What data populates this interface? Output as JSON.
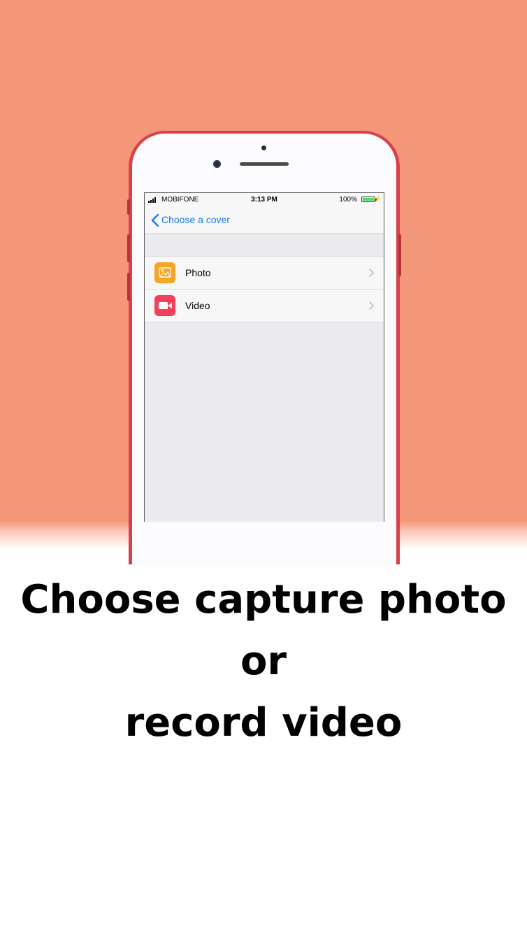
{
  "status_bar": {
    "carrier": "MOBIFONE",
    "time": "3:13 PM",
    "battery": "100%"
  },
  "nav": {
    "back_label": "Choose a cover"
  },
  "options": [
    {
      "label": "Photo",
      "icon": "photo-icon",
      "color": "#f5a623"
    },
    {
      "label": "Video",
      "icon": "video-camera-icon",
      "color": "#f2405d"
    }
  ],
  "caption": {
    "line1": "Choose capture photo",
    "line2": "or",
    "line3": "record video"
  },
  "colors": {
    "background": "#f49778",
    "phone": "#d8404c",
    "tint": "#1a7cf2"
  }
}
